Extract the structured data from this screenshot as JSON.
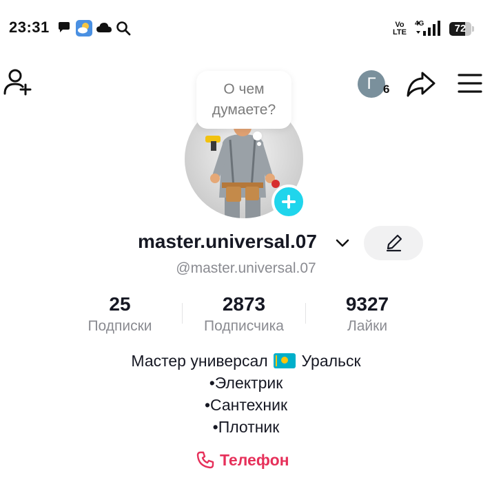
{
  "status_bar": {
    "time": "23:31",
    "icons": [
      "chat-bubble-icon",
      "weather-icon",
      "cloud-icon",
      "search-icon"
    ],
    "volte": "Vo LTE",
    "network": "4G",
    "battery": "72",
    "battery_level": 0.72
  },
  "top_bar": {
    "notification_avatar_letter": "Г",
    "notification_count": "6"
  },
  "avatar": {
    "bubble_text": "О чем думаете?"
  },
  "profile": {
    "username": "master.universal.07",
    "handle": "@master.universal.07"
  },
  "stats": [
    {
      "value": "25",
      "label": "Подписки"
    },
    {
      "value": "2873",
      "label": "Подписчика"
    },
    {
      "value": "9327",
      "label": "Лайки"
    }
  ],
  "bio": {
    "line1_before": "Мастер универсал",
    "line1_after": "Уральск",
    "line2": "•Электрик",
    "line3": "•Сантехник",
    "line4": "•Плотник"
  },
  "contact": {
    "phone_label": "Телефон"
  },
  "colors": {
    "accent_cyan": "#20d5ec",
    "phone_red": "#e6305a",
    "secondary_text": "#8a8b91",
    "edit_button_bg": "#f1f1f2"
  }
}
